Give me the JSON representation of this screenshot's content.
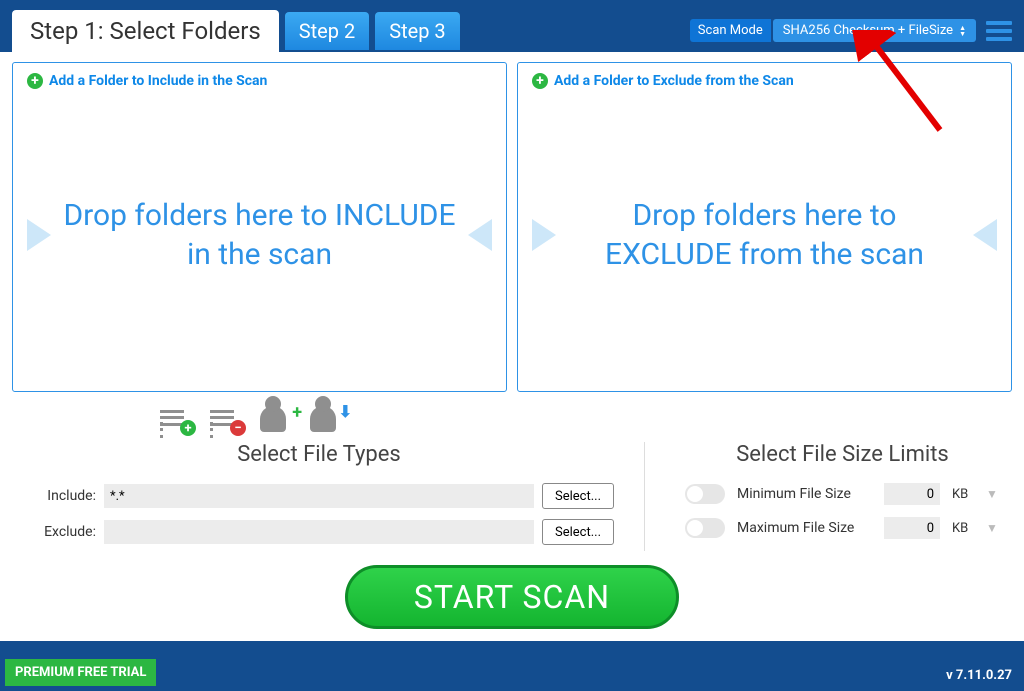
{
  "tabs": {
    "step1": "Step 1: Select Folders",
    "step2": "Step 2",
    "step3": "Step 3"
  },
  "header": {
    "scan_mode_label": "Scan Mode",
    "scan_mode_value": "SHA256 Checksum + FileSize"
  },
  "include_panel": {
    "add_link": "Add a Folder to Include in the Scan",
    "drop_text": "Drop folders here to INCLUDE in the scan"
  },
  "exclude_panel": {
    "add_link": "Add a Folder to Exclude from the Scan",
    "drop_text": "Drop folders here to EXCLUDE from the scan"
  },
  "file_types": {
    "title": "Select File Types",
    "include_label": "Include:",
    "include_value": "*.*",
    "exclude_label": "Exclude:",
    "exclude_value": "",
    "select_btn": "Select..."
  },
  "size_limits": {
    "title": "Select File Size Limits",
    "min_label": "Minimum File Size",
    "min_value": "0",
    "min_unit": "KB",
    "max_label": "Maximum File Size",
    "max_value": "0",
    "max_unit": "KB"
  },
  "start_btn": "START SCAN",
  "footer": {
    "trial": "PREMIUM FREE TRIAL",
    "version": "v 7.11.0.27"
  }
}
